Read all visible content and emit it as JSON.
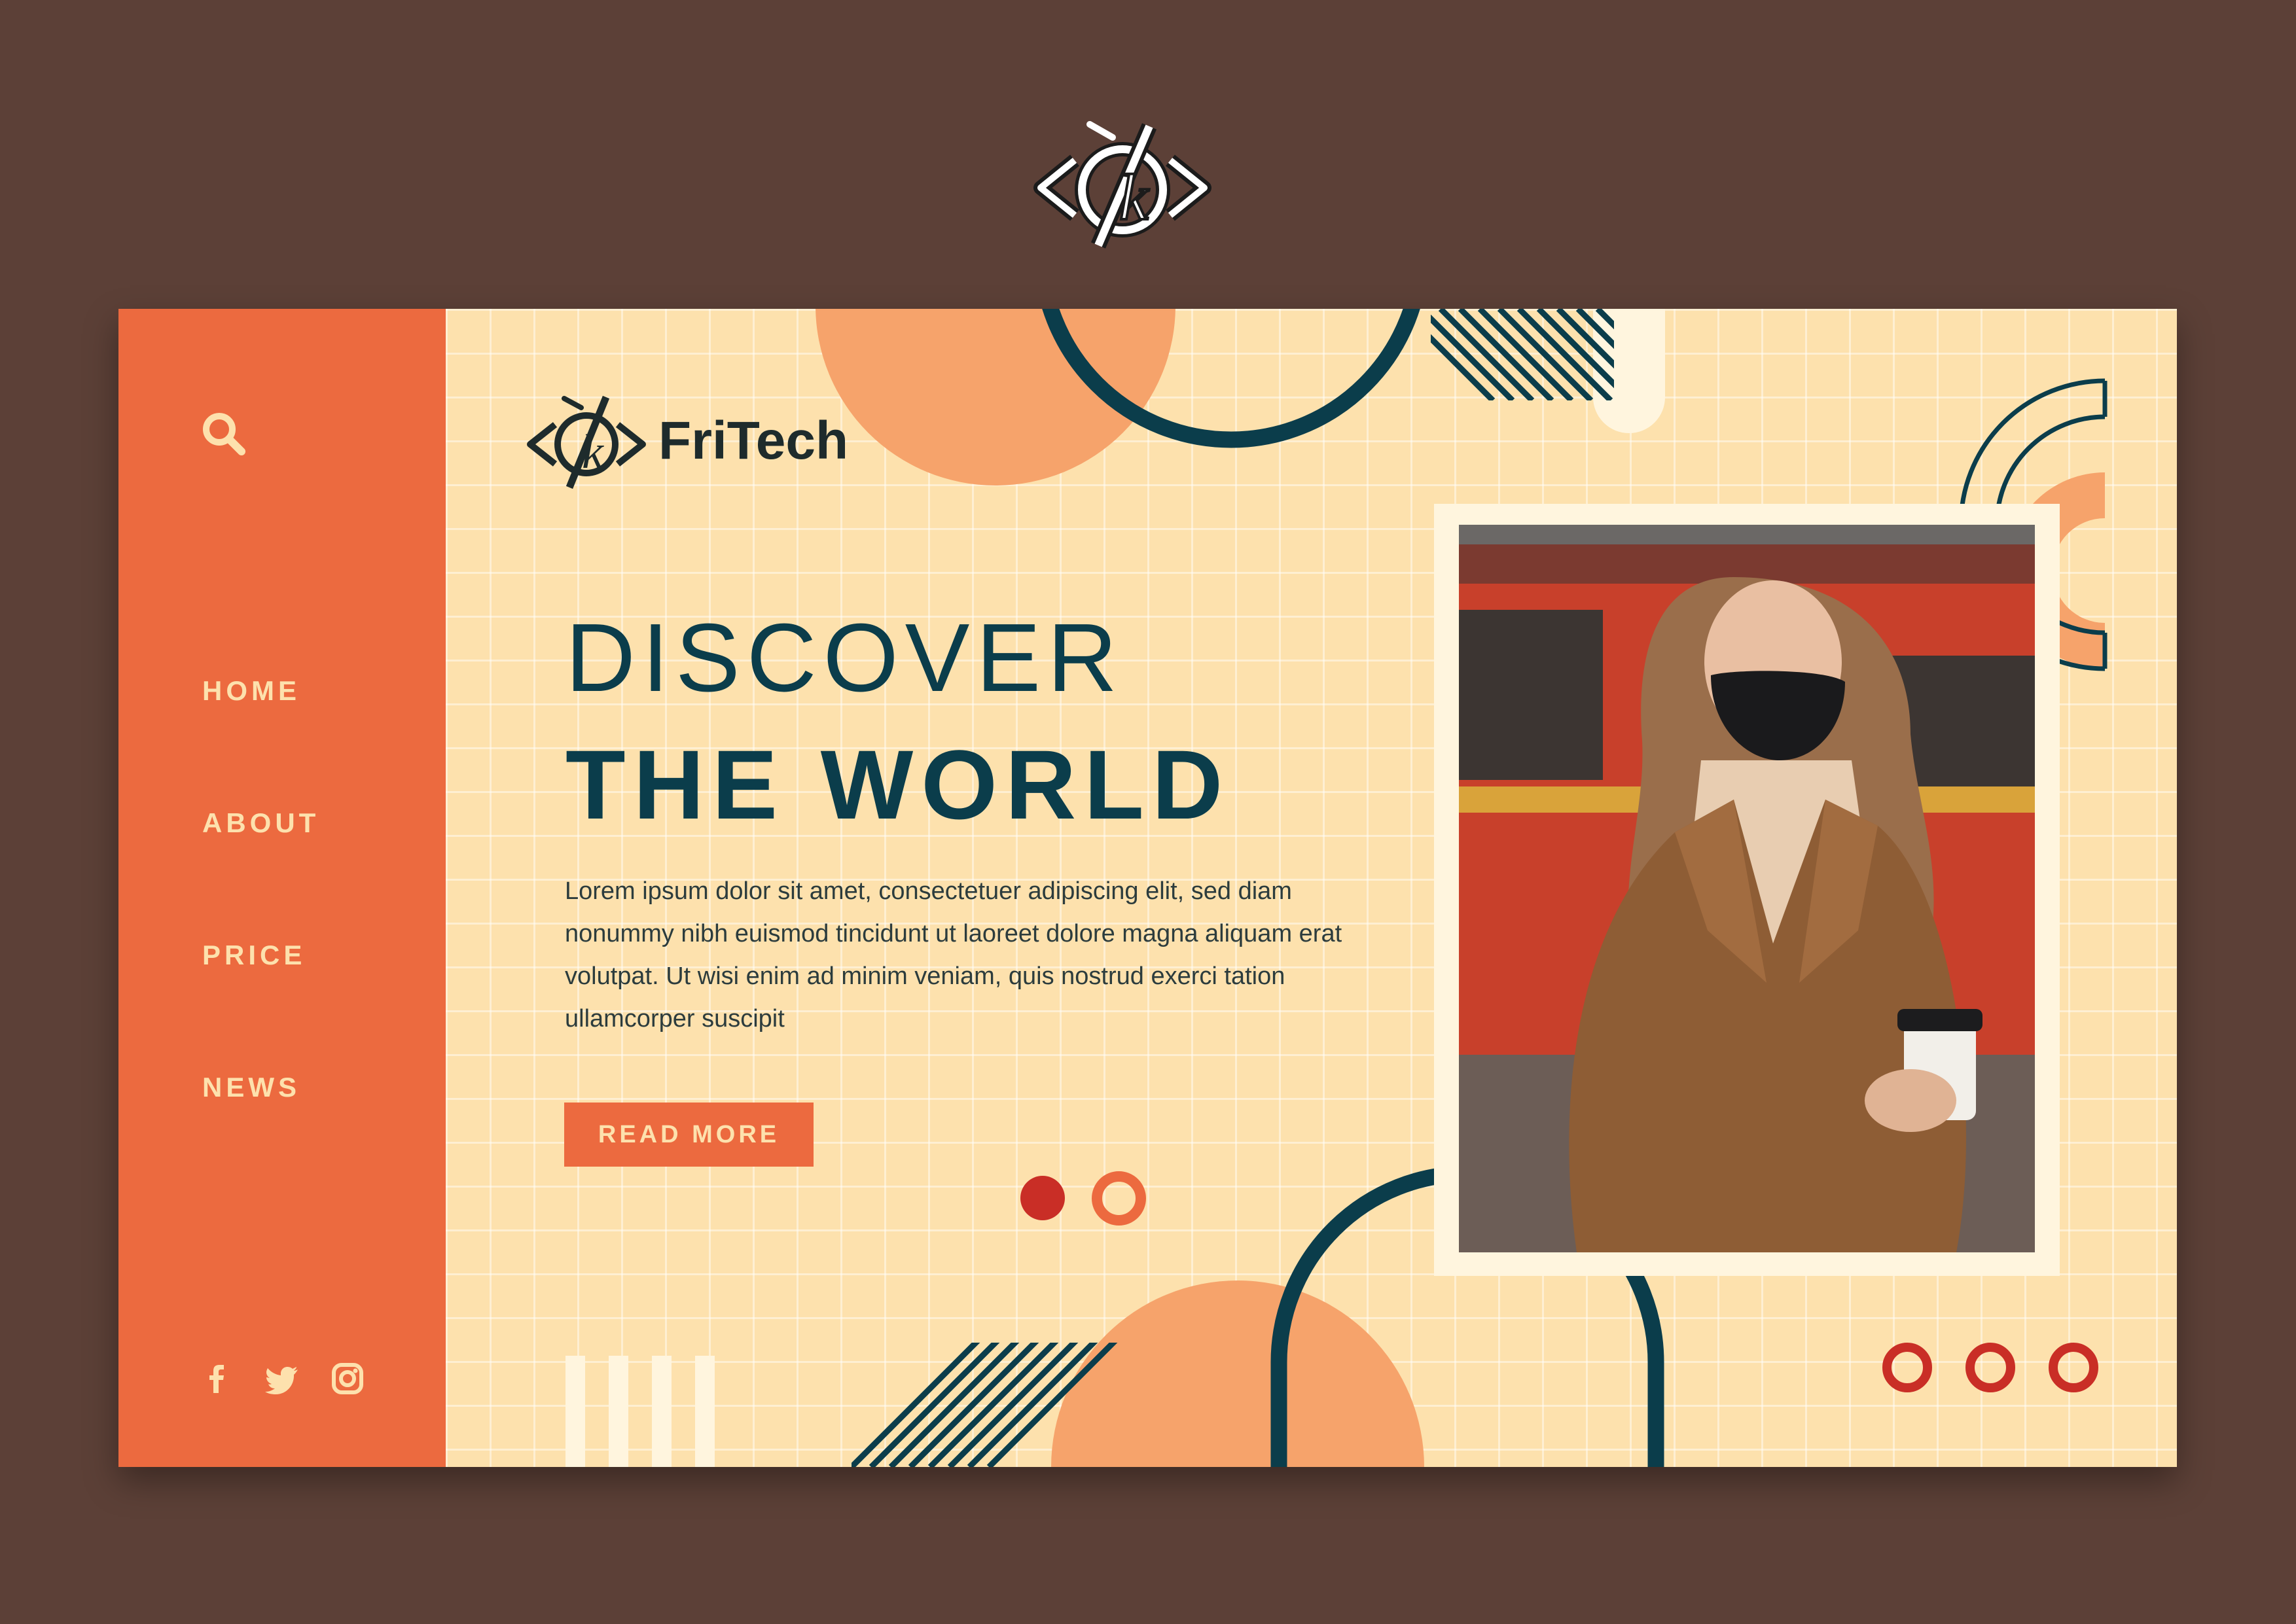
{
  "brand": {
    "name": "FriTech"
  },
  "nav": {
    "items": [
      {
        "label": "HOME"
      },
      {
        "label": "ABOUT"
      },
      {
        "label": "PRICE"
      },
      {
        "label": "NEWS"
      }
    ]
  },
  "icons": {
    "search": "search-icon",
    "socials": [
      "facebook-icon",
      "twitter-icon",
      "instagram-icon"
    ]
  },
  "hero": {
    "headline_line1": "DISCOVER",
    "headline_line2": "THE WORLD",
    "body": "Lorem ipsum dolor sit amet, consectetuer adipiscing elit, sed diam nonummy nibh euismod tincidunt ut laoreet dolore magna aliquam erat volutpat. Ut wisi enim ad minim veniam, quis nostrud exerci tation ullamcorper suscipit",
    "cta_label": "READ MORE"
  },
  "carousel": {
    "slide_count": 2,
    "active_slide": 1
  },
  "colors": {
    "background": "#5c4037",
    "card": "#fde1ad",
    "sidebar": "#ec6a3f",
    "peach": "#f6a36b",
    "teal": "#0b3d4b",
    "red": "#c92e26",
    "cream": "#fff5de"
  }
}
